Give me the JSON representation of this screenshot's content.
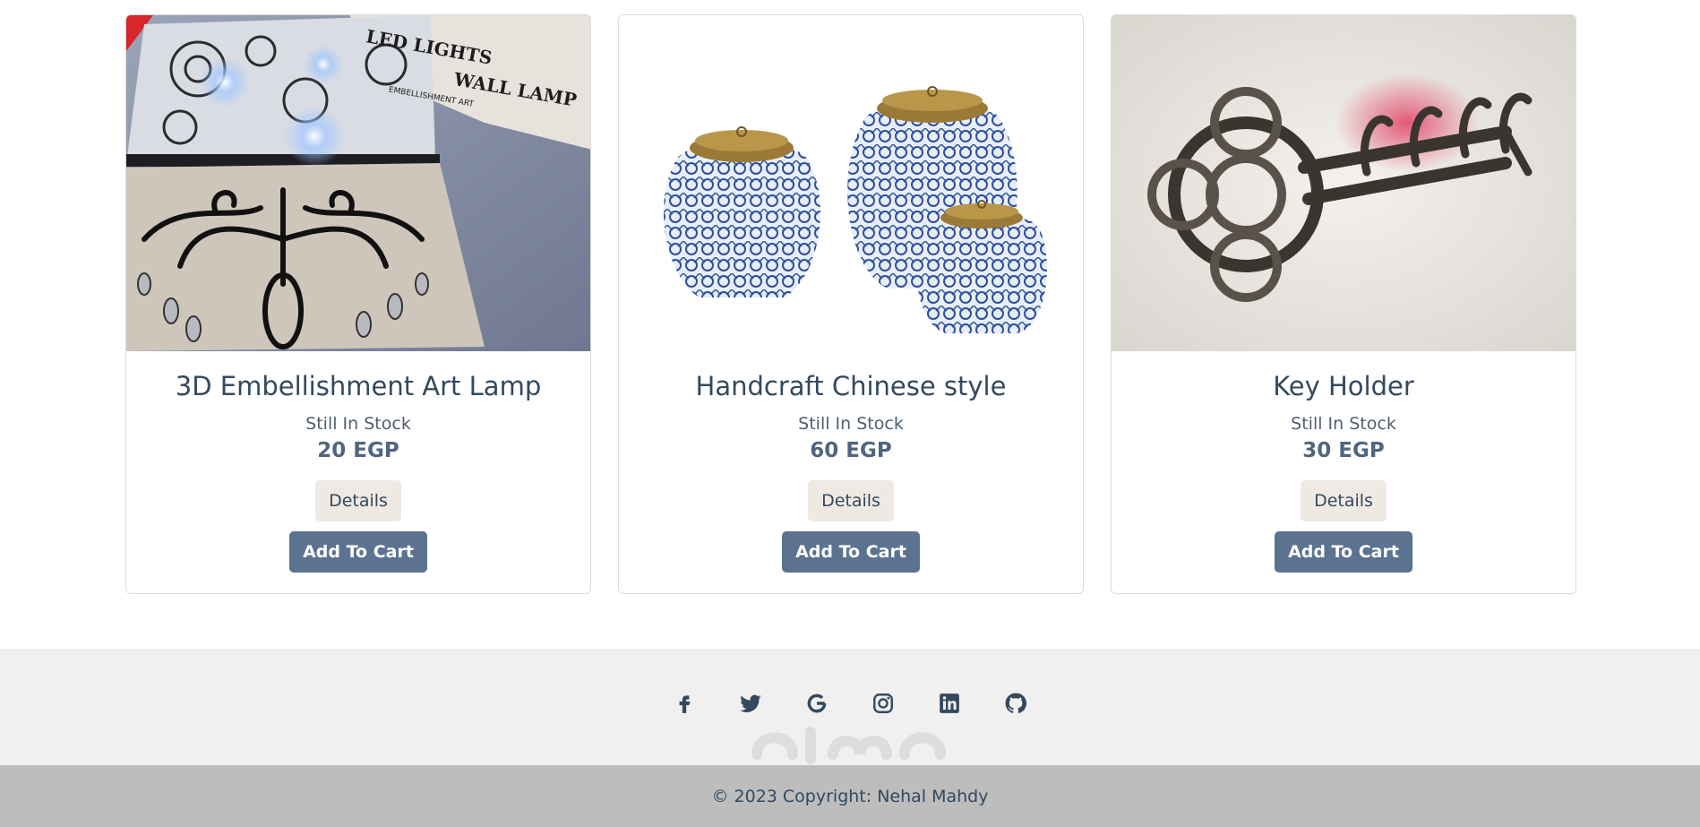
{
  "products": [
    {
      "title": "3D Embellishment Art Lamp",
      "stock": "Still In Stock",
      "price": "20 EGP",
      "details_label": "Details",
      "cart_label": "Add To Cart",
      "image_text_top": "LED LIGHTS",
      "image_text_bottom": "WALL LAMP",
      "image_text_small": "EMBELLISHMENT ART"
    },
    {
      "title": "Handcraft Chinese style",
      "stock": "Still In Stock",
      "price": "60 EGP",
      "details_label": "Details",
      "cart_label": "Add To Cart"
    },
    {
      "title": "Key Holder",
      "stock": "Still In Stock",
      "price": "30 EGP",
      "details_label": "Details",
      "cart_label": "Add To Cart"
    }
  ],
  "footer": {
    "social_icons": [
      "facebook-icon",
      "twitter-icon",
      "google-icon",
      "instagram-icon",
      "linkedin-icon",
      "github-icon"
    ],
    "copyright": "© 2023 Copyright: Nehal Mahdy",
    "icon_color": "#34495e",
    "social_bg": "#f0f0f0",
    "copyright_bg": "#bdbdbd"
  },
  "colors": {
    "cart_button": "#5b7390",
    "details_button": "#efe9e3",
    "text": "#34495e"
  }
}
